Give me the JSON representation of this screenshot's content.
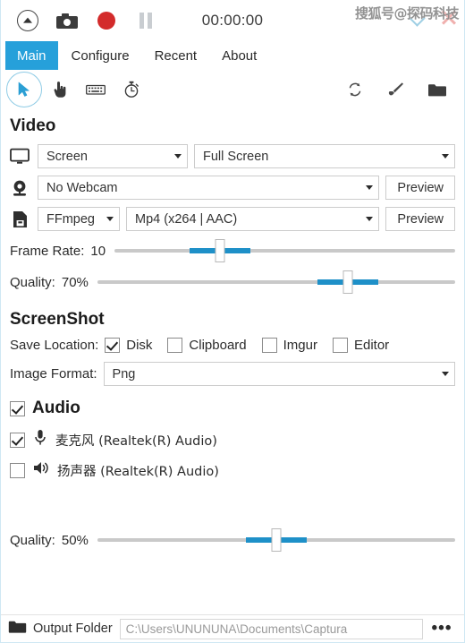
{
  "titlebar": {
    "expand_icon": "up-arrow-circle-icon",
    "screenshot_icon": "camera-icon",
    "record_icon": "record-circle-icon",
    "pause_icon": "pause-icon",
    "timer": "00:00:00",
    "watermark": "搜狐号@探码科技",
    "minimize_icon": "chevron-down-icon",
    "close_icon": "close-icon",
    "accent_color": "#26a0da",
    "record_color": "#d32b2b"
  },
  "tabs": [
    {
      "label": "Main",
      "active": true
    },
    {
      "label": "Configure",
      "active": false
    },
    {
      "label": "Recent",
      "active": false
    },
    {
      "label": "About",
      "active": false
    }
  ],
  "toolbar": {
    "left": [
      {
        "name": "cursor-icon",
        "selected": true
      },
      {
        "name": "click-hand-icon",
        "selected": false
      },
      {
        "name": "keyboard-icon",
        "selected": false
      },
      {
        "name": "stopwatch-icon",
        "selected": false
      }
    ],
    "right": [
      {
        "name": "refresh-icon"
      },
      {
        "name": "brush-icon"
      },
      {
        "name": "folder-icon"
      }
    ]
  },
  "video": {
    "title": "Video",
    "source_icon": "monitor-icon",
    "source": "Screen",
    "source_region": "Full Screen",
    "webcam_icon": "webcam-icon",
    "webcam": "No Webcam",
    "webcam_preview": "Preview",
    "encoder_icon": "file-save-icon",
    "encoder": "FFmpeg",
    "format": "Mp4 (x264 | AAC)",
    "format_preview": "Preview",
    "frame_rate_label": "Frame Rate:",
    "frame_rate_value": "10",
    "frame_rate_pct": 31,
    "quality_label": "Quality:",
    "quality_value": "70%",
    "quality_pct": 70
  },
  "screenshot": {
    "title": "ScreenShot",
    "save_location_label": "Save Location:",
    "targets": [
      {
        "label": "Disk",
        "checked": true
      },
      {
        "label": "Clipboard",
        "checked": false
      },
      {
        "label": "Imgur",
        "checked": false
      },
      {
        "label": "Editor",
        "checked": false
      }
    ],
    "image_format_label": "Image Format:",
    "image_format": "Png"
  },
  "audio": {
    "title": "Audio",
    "enabled": true,
    "devices": [
      {
        "icon": "microphone-icon",
        "name": "麦克风 (Realtek(R) Audio)",
        "checked": true
      },
      {
        "icon": "speaker-icon",
        "name": "扬声器 (Realtek(R) Audio)",
        "checked": false
      }
    ],
    "quality_label": "Quality:",
    "quality_value": "50%",
    "quality_pct": 50
  },
  "statusbar": {
    "folder_icon": "folder-icon",
    "output_folder_label": "Output Folder",
    "output_path": "C:\\Users\\UNUNUNA\\Documents\\Captura",
    "more_label": "•••"
  }
}
